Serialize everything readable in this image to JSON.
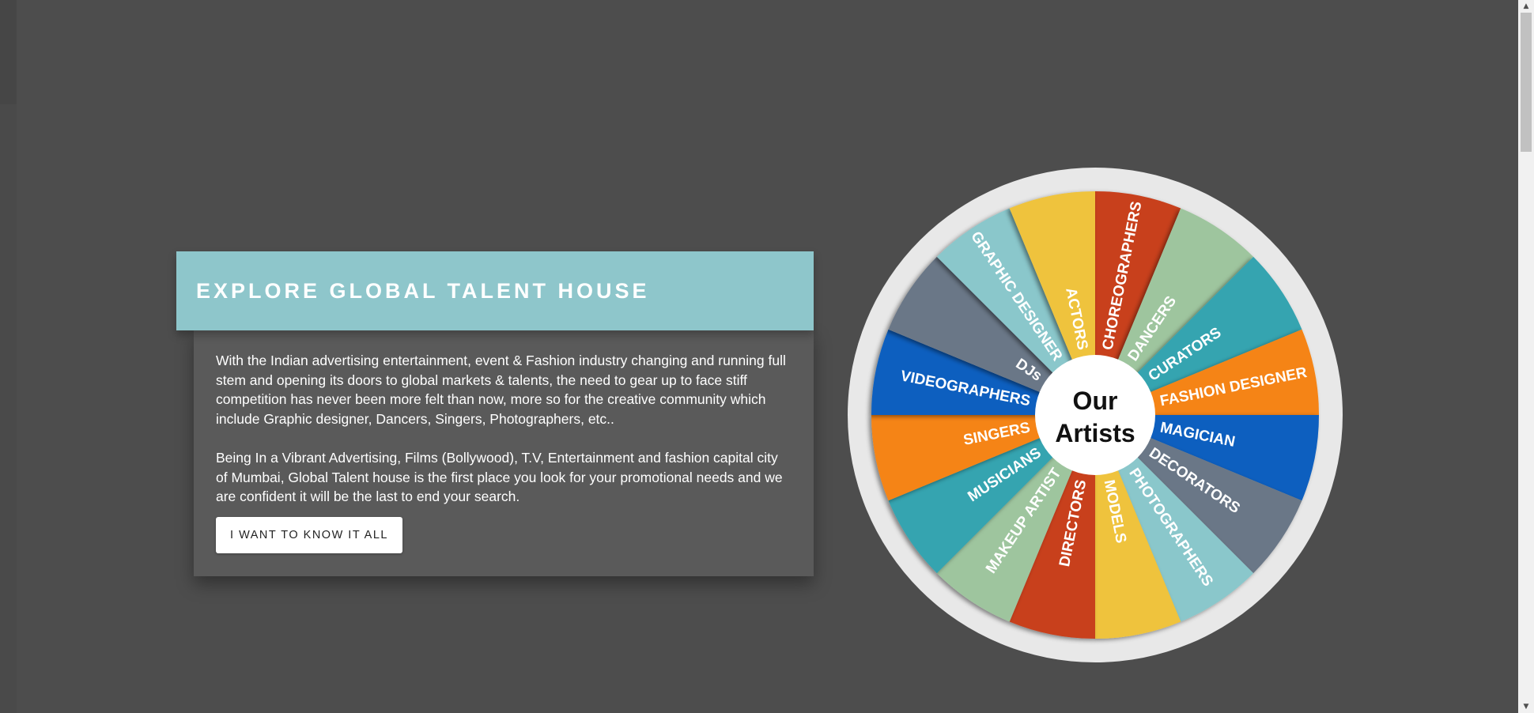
{
  "intro": {
    "title": "EXPLORE GLOBAL TALENT HOUSE",
    "paragraphs": [
      "With the Indian advertising entertainment, event & Fashion industry changing and running full stem and opening its doors to global markets & talents, the need to gear up to face stiff competition has never been more felt than now, more so for the creative community which include Graphic designer, Dancers, Singers, Photographers, etc..",
      "Being In a Vibrant Advertising, Films (Bollywood), T.V, Entertainment and fashion capital city of Mumbai, Global Talent house is the first place you look for your promotional needs and we are confident it will be the last to end your search."
    ],
    "cta_label": "I WANT TO KNOW IT ALL"
  },
  "wheel": {
    "center_line1": "Our",
    "center_line2": "Artists",
    "segments": [
      {
        "label": "CHOREOGRAPHERS",
        "color": "#c8401f"
      },
      {
        "label": "DANCERS",
        "color": "#9ec59e"
      },
      {
        "label": "CURATORS",
        "color": "#35a4b0"
      },
      {
        "label": "FASHION DESIGNER",
        "color": "#f58412"
      },
      {
        "label": "MAGICIAN",
        "color": "#0b5fbf"
      },
      {
        "label": "DECORATORS",
        "color": "#6a7787"
      },
      {
        "label": "PHOTOGRAPHERS",
        "color": "#8ac7cb"
      },
      {
        "label": "MODELS",
        "color": "#efc33c"
      },
      {
        "label": "DIRECTORS",
        "color": "#c8401f"
      },
      {
        "label": "MAKEUP ARTIST",
        "color": "#9ec59e"
      },
      {
        "label": "MUSICIANS",
        "color": "#35a4b0"
      },
      {
        "label": "SINGERS",
        "color": "#f58412"
      },
      {
        "label": "VIDEOGRAPHERS",
        "color": "#0b5fbf"
      },
      {
        "label": "DJs",
        "color": "#6a7787"
      },
      {
        "label": "GRAPHIC DESIGNER",
        "color": "#8ac7cb"
      },
      {
        "label": "ACTORS",
        "color": "#efc33c"
      }
    ]
  }
}
